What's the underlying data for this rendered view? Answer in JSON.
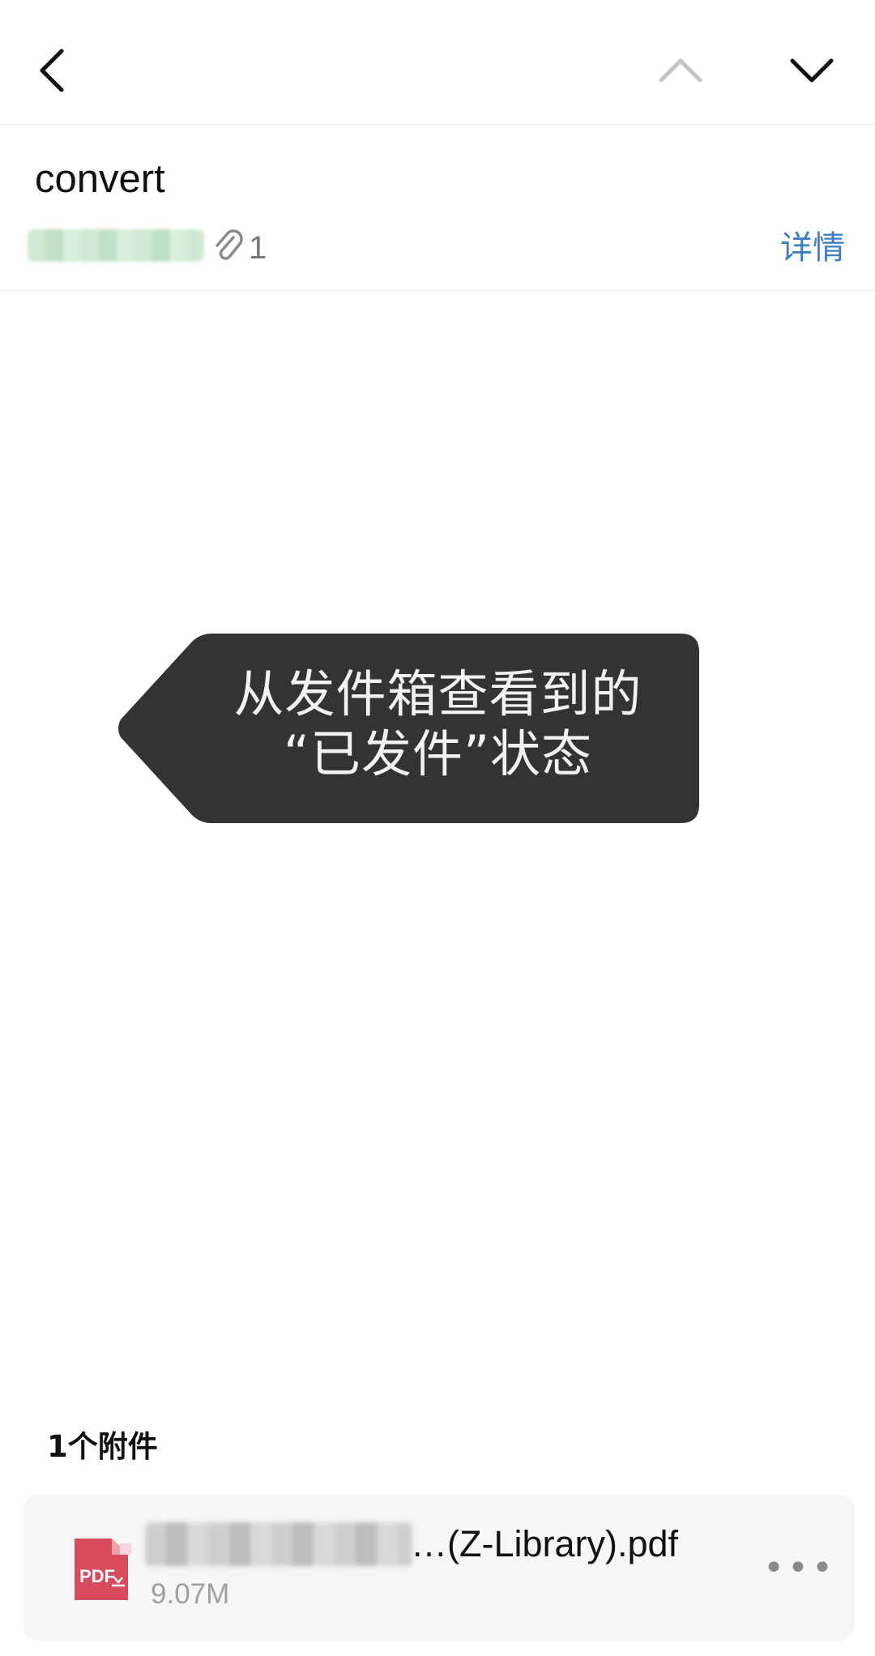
{
  "nav": {
    "back_icon": "chevron-left-icon",
    "prev_icon": "chevron-up-icon",
    "next_icon": "chevron-down-icon"
  },
  "message": {
    "subject": "convert",
    "attachment_count": "1",
    "details_label": "详情"
  },
  "callout": {
    "line1": "从发件箱查看到的",
    "line2": "“已发件”状态"
  },
  "attachments": {
    "heading": "1个附件",
    "items": [
      {
        "name": "…(Z-Library).pdf",
        "size": "9.07M",
        "type_icon": "pdf-file-icon"
      }
    ]
  },
  "colors": {
    "link": "#3d7fc4",
    "callout_bg": "#333333",
    "pdf_icon": "#d84a5d"
  }
}
